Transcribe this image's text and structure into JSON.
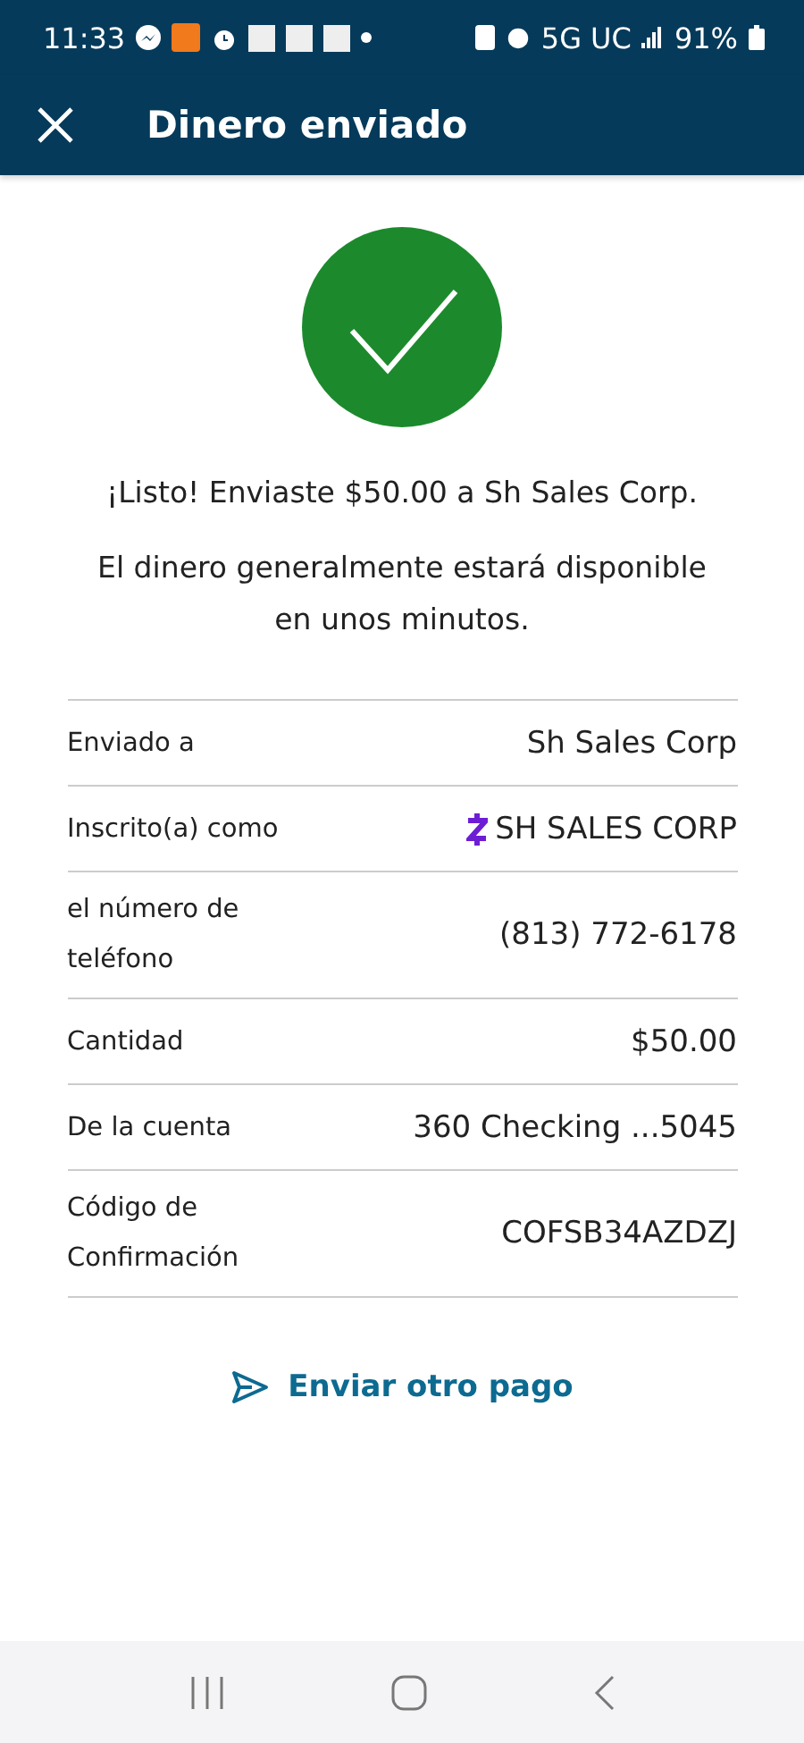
{
  "status_bar": {
    "time": "11:33",
    "network": "5G UC",
    "battery": "91%"
  },
  "header": {
    "title": "Dinero enviado"
  },
  "message": "¡Listo! Enviaste $50.00 a Sh Sales Corp.",
  "note": "El dinero generalmente estará disponible en unos minutos.",
  "details": [
    {
      "kind": "plain",
      "label": "Enviado a",
      "value": "Sh Sales Corp"
    },
    {
      "kind": "zelle",
      "label": "Inscrito(a) como",
      "value": "SH SALES CORP"
    },
    {
      "kind": "plain",
      "label": "el número de teléfono",
      "value": "(813) 772-6178"
    },
    {
      "kind": "plain",
      "label": "Cantidad",
      "value": "$50.00"
    },
    {
      "kind": "plain",
      "label": "De la cuenta",
      "value": "360 Checking ...5045"
    },
    {
      "kind": "plain",
      "label": "Código de Confirmación",
      "value": "COFSB34AZDZJ"
    }
  ],
  "action": "Enviar otro pago"
}
